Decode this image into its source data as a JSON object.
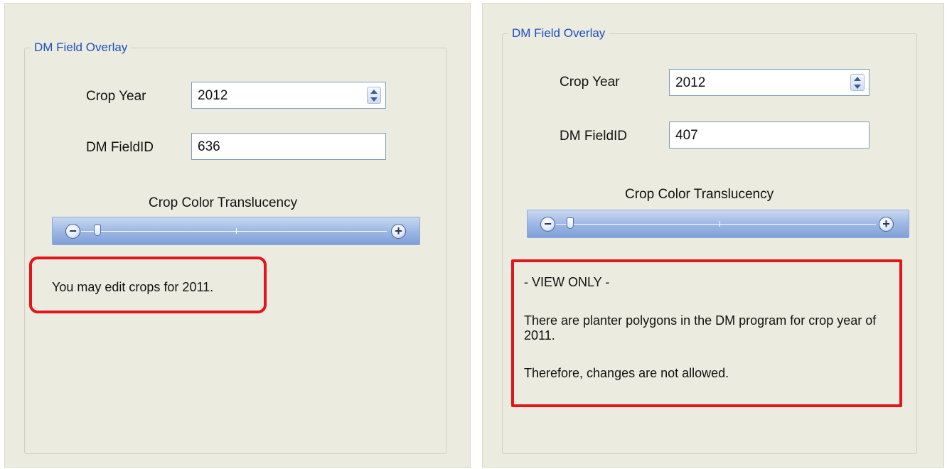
{
  "left_panel": {
    "group_title": "DM Field Overlay",
    "crop_year_label": "Crop Year",
    "crop_year_value": "2012",
    "field_id_label": "DM FieldID",
    "field_id_value": "636",
    "translucency_label": "Crop Color Translucency",
    "slider_minus": "−",
    "slider_plus": "+",
    "slider_level": 0.0,
    "message": "You may edit crops for 2011."
  },
  "right_panel": {
    "group_title": "DM Field Overlay",
    "crop_year_label": "Crop Year",
    "crop_year_value": "2012",
    "field_id_label": "DM FieldID",
    "field_id_value": "407",
    "translucency_label": "Crop Color Translucency",
    "slider_minus": "−",
    "slider_plus": "+",
    "slider_level": 0.0,
    "message_heading": "- VIEW ONLY -",
    "message_line1": "There are planter polygons in the DM program for crop year of 2011.",
    "message_line2": "Therefore, changes are not allowed."
  },
  "colors": {
    "panel_bg": "#ecebe0",
    "legend_text": "#1c4fc0",
    "highlight_border": "#e3141a",
    "slider_blue": "#a2bbe6"
  }
}
